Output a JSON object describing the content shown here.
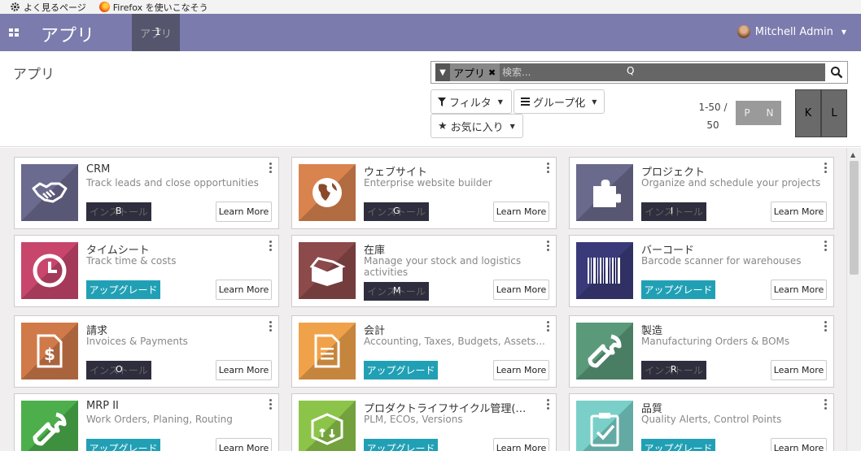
{
  "bookmarks": [
    {
      "label": "よく見るページ",
      "icon": "gear-icon"
    },
    {
      "label": "Firefox を使いこなそう",
      "icon": "firefox-icon"
    }
  ],
  "nav": {
    "brand": "アプリ",
    "active_menu": "アプリ",
    "active_menu_hint": "1",
    "user": "Mitchell Admin"
  },
  "control": {
    "breadcrumb": "アプリ",
    "search": {
      "facet": "アプリ",
      "placeholder": "検索...",
      "hint": "Q"
    },
    "filters_label": "フィルタ",
    "group_label": "グループ化",
    "favorites_label": "お気に入り",
    "pager_value": "1-50 / 50",
    "pager_prev": "P",
    "pager_next": "N",
    "view_kanban": "K",
    "view_list": "L"
  },
  "colors": {
    "navbar": "#7c7bad",
    "upgrade": "#21a0b5",
    "install": "#2e2e3e"
  },
  "apps": [
    {
      "name": "CRM",
      "desc": "Track leads and close opportunities",
      "action": "install",
      "action_label": "インストール",
      "hint": "B",
      "color": "#6b6a8f",
      "icon": "handshake-icon"
    },
    {
      "name": "ウェブサイト",
      "desc": "Enterprise website builder",
      "action": "install",
      "action_label": "インストール",
      "hint": "G",
      "color": "#d9834f",
      "icon": "globe-icon"
    },
    {
      "name": "プロジェクト",
      "desc": "Organize and schedule your projects",
      "action": "install",
      "action_label": "インストール",
      "hint": "I",
      "color": "#6a6a8c",
      "icon": "puzzle-icon"
    },
    {
      "name": "タイムシート",
      "desc": "Track time & costs",
      "action": "upgrade",
      "action_label": "アップグレード",
      "hint": "",
      "color": "#c8466c",
      "icon": "clock-icon"
    },
    {
      "name": "在庫",
      "desc": "Manage your stock and logistics activities",
      "action": "install",
      "action_label": "インストール",
      "hint": "M",
      "color": "#8c4a4a",
      "icon": "box-icon"
    },
    {
      "name": "バーコード",
      "desc": "Barcode scanner for warehouses",
      "action": "upgrade",
      "action_label": "アップグレード",
      "hint": "",
      "color": "#3a3a7a",
      "icon": "barcode-icon"
    },
    {
      "name": "請求",
      "desc": "Invoices & Payments",
      "action": "install",
      "action_label": "インストール",
      "hint": "O",
      "color": "#d07a4a",
      "icon": "invoice-icon"
    },
    {
      "name": "会計",
      "desc": "Accounting, Taxes, Budgets, Assets...",
      "action": "upgrade",
      "action_label": "アップグレード",
      "hint": "",
      "color": "#f0a24a",
      "icon": "document-icon"
    },
    {
      "name": "製造",
      "desc": "Manufacturing Orders & BOMs",
      "action": "install",
      "action_label": "インストール",
      "hint": "R",
      "color": "#5a9a7a",
      "icon": "wrench-icon"
    },
    {
      "name": "MRP II",
      "desc": "Work Orders, Planing, Routing",
      "action": "upgrade",
      "action_label": "アップグレード",
      "hint": "",
      "color": "#4caf4c",
      "icon": "wrench-icon"
    },
    {
      "name": "プロダクトライフサイクル管理(…",
      "desc": "PLM, ECOs, Versions",
      "action": "upgrade",
      "action_label": "アップグレード",
      "hint": "",
      "color": "#8cc44a",
      "icon": "package-icon"
    },
    {
      "name": "品質",
      "desc": "Quality Alerts, Control Points",
      "action": "upgrade",
      "action_label": "アップグレード",
      "hint": "",
      "color": "#7ad0c8",
      "icon": "clipboard-check-icon"
    }
  ],
  "learn_more_label": "Learn More"
}
